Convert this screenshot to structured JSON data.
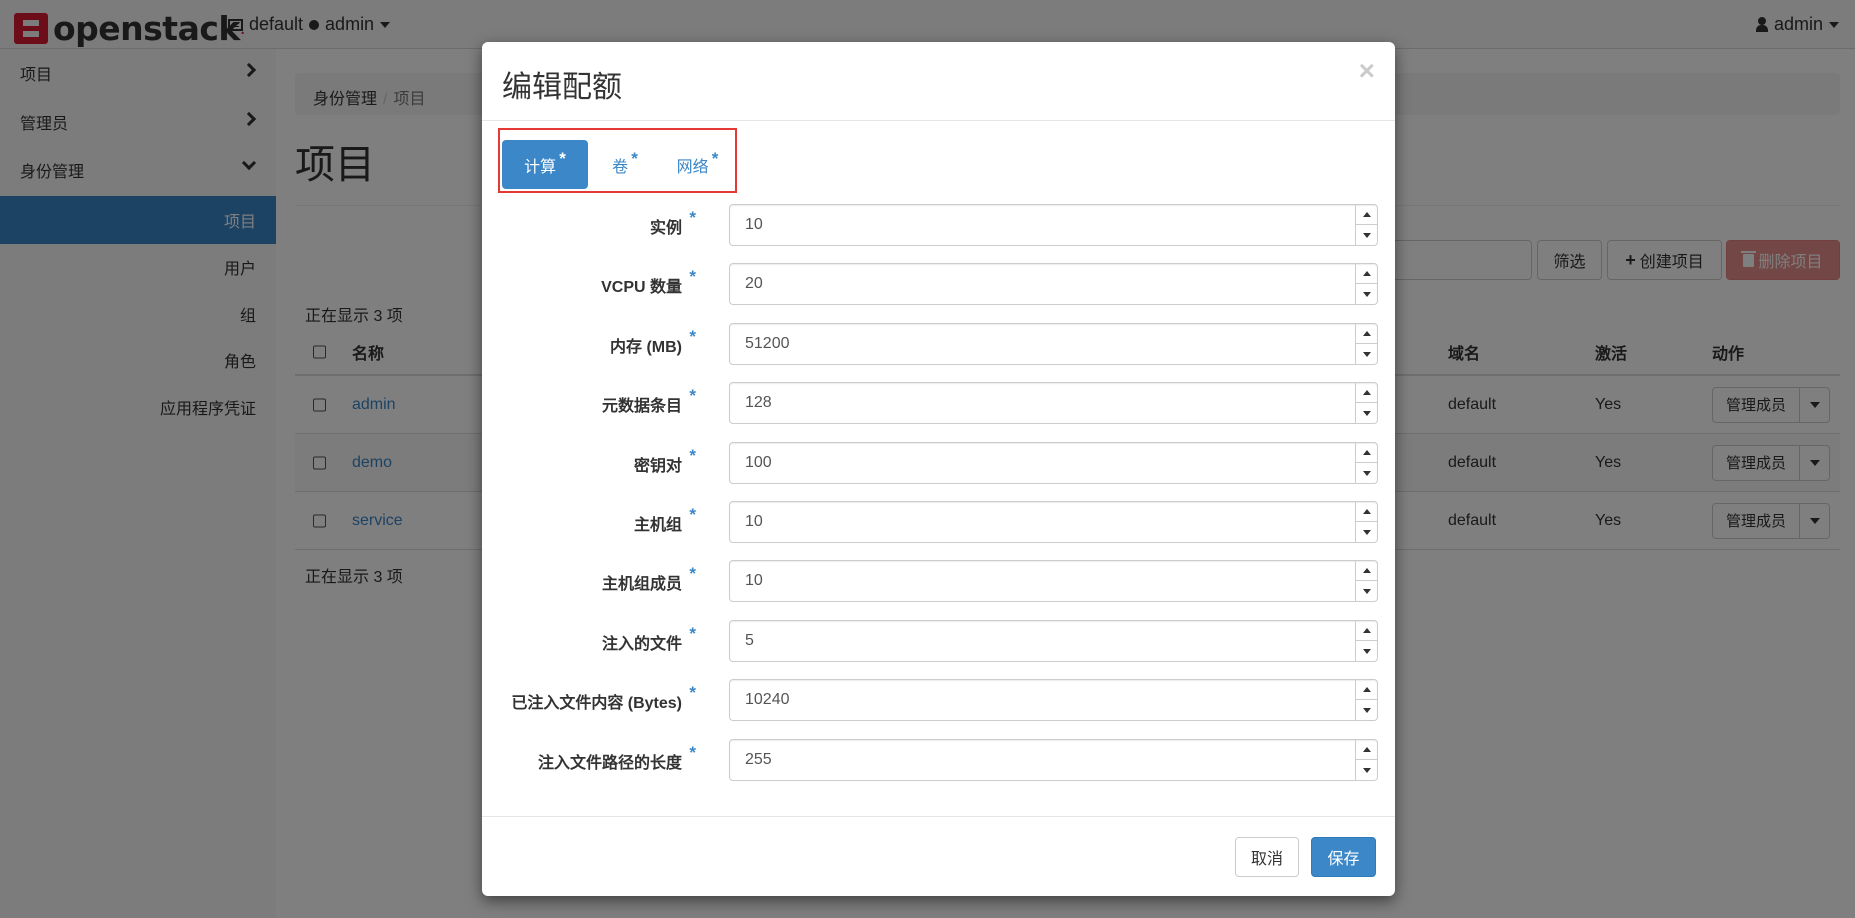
{
  "navbar": {
    "brand": "openstack",
    "context": {
      "domain": "default",
      "project": "admin"
    },
    "user": "admin"
  },
  "sidebar": {
    "items": [
      {
        "label": "项目",
        "expanded": false
      },
      {
        "label": "管理员",
        "expanded": false
      },
      {
        "label": "身份管理",
        "expanded": true
      }
    ],
    "subitems": [
      {
        "label": "项目",
        "active": true
      },
      {
        "label": "用户",
        "active": false
      },
      {
        "label": "组",
        "active": false
      },
      {
        "label": "角色",
        "active": false
      },
      {
        "label": "应用程序凭证",
        "active": false
      }
    ]
  },
  "main": {
    "breadcrumb": [
      "身份管理",
      "项目"
    ],
    "title": "项目",
    "actions": {
      "filter": "筛选",
      "create": "创建项目",
      "delete": "删除项目"
    },
    "count_text": "正在显示 3 项",
    "table": {
      "columns": [
        "名称",
        "域名",
        "激活",
        "动作"
      ],
      "rows": [
        {
          "name": "admin",
          "domain": "default",
          "enabled": "Yes",
          "action": "管理成员"
        },
        {
          "name": "demo",
          "domain": "default",
          "enabled": "Yes",
          "action": "管理成员"
        },
        {
          "name": "service",
          "domain": "default",
          "enabled": "Yes",
          "action": "管理成员"
        }
      ]
    }
  },
  "modal": {
    "title": "编辑配额",
    "close": "×",
    "tabs": [
      {
        "label": "计算",
        "active": true
      },
      {
        "label": "卷",
        "active": false
      },
      {
        "label": "网络",
        "active": false
      }
    ],
    "required_mark": "*",
    "fields": [
      {
        "label": "实例",
        "value": "10"
      },
      {
        "label": "VCPU 数量",
        "value": "20"
      },
      {
        "label": "内存 (MB)",
        "value": "51200"
      },
      {
        "label": "元数据条目",
        "value": "128"
      },
      {
        "label": "密钥对",
        "value": "100"
      },
      {
        "label": "主机组",
        "value": "10"
      },
      {
        "label": "主机组成员",
        "value": "10"
      },
      {
        "label": "注入的文件",
        "value": "5"
      },
      {
        "label": "已注入文件内容 (Bytes)",
        "value": "10240"
      },
      {
        "label": "注入文件路径的长度",
        "value": "255"
      }
    ],
    "footer": {
      "cancel": "取消",
      "save": "保存"
    }
  },
  "colors": {
    "primary": "#3b87c8",
    "danger": "#d9534f",
    "brand_red": "#da1a32",
    "highlight_box": "#e53935"
  }
}
